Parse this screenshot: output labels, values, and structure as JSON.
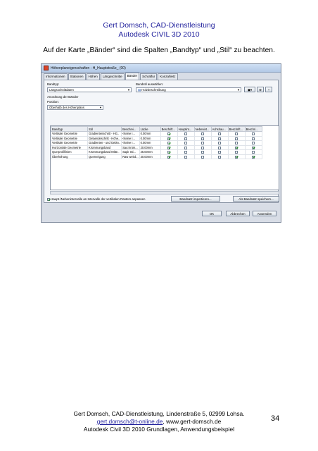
{
  "header": {
    "line1": "Gert Domsch, CAD-Dienstleistung",
    "line2": "Autodesk CIVIL 3D 2010"
  },
  "intro": "Auf der Karte „Bänder“ sind die Spalten „Bandtyp“ und „Stil“ zu beachten.",
  "dialog": {
    "title": "Höhenplaneigenschaften - H_Hauptstraße_ (00)",
    "tabs": [
      "Informationen",
      "Stationen",
      "Höhen",
      "Längsschnitte",
      "Bänder",
      "Schraffur",
      "Konzahletz"
    ],
    "active_tab": "Bänder",
    "bandtyp_label": "Bandtyp:",
    "bandtyp_value": "Längsschnittdaten",
    "bandstil_label": "Bandstil auswählen:",
    "bandstil_value": "Holzbeschreibung",
    "anordnung_label": "Anordnung der Bänder",
    "position_label": "Position:",
    "position_value": "Oberhalb des Höhenplans",
    "columns": [
      "Bandtyp",
      "Stil",
      "Beschrei...",
      "Lücke",
      "Beschrift...",
      "Hauptint...",
      "Nebenint...",
      "Achshau...",
      "Beschrift...",
      "Beschri..."
    ],
    "rows": [
      {
        "bandtyp": "Vertikale Geometrie",
        "stil": "Gradientenschritt - HG..",
        "beschr": "<keine I...",
        "luecke": "0.00mm",
        "c1": true,
        "c2": false,
        "c3": false,
        "c4": false,
        "c5": false,
        "c6": false
      },
      {
        "bandtyp": "Vertikale Geometrie",
        "stil": "Gelaendeschritt - Höhe..",
        "beschr": "<keine I...",
        "luecke": "0.00mm",
        "c1": true,
        "c2": false,
        "c3": false,
        "c4": false,
        "c5": false,
        "c6": false
      },
      {
        "bandtyp": "Vertikale Geometrie",
        "stil": "Gradienten - und Gelän..",
        "beschr": "<keine I...",
        "luecke": "0.00mm",
        "c1": true,
        "c2": false,
        "c3": false,
        "c4": false,
        "c5": false,
        "c6": false
      },
      {
        "bandtyp": "Horizontale Geometrie",
        "stil": "Krümmungsband",
        "beschr": "Sau:Krüm...",
        "luecke": "20.00mm",
        "c1": true,
        "c2": false,
        "c3": false,
        "c4": false,
        "c5": true,
        "c6": true
      },
      {
        "bandtyp": "Querprofillinien",
        "stil": "Krümmungsband Mitte..",
        "beschr": "Sapir Sti...",
        "luecke": "25.00mm",
        "c1": true,
        "c2": false,
        "c3": false,
        "c4": false,
        "c5": false,
        "c6": false
      },
      {
        "bandtyp": "Überhöhung",
        "stil": "Querneigung",
        "beschr": "Raw weird...",
        "luecke": "30.00mm",
        "c1": true,
        "c2": false,
        "c3": false,
        "c4": false,
        "c5": true,
        "c6": true
      }
    ],
    "sync_label": "Haupt-/Nebenintervalle an Intervalle der vertikalen Rasters anpassen",
    "btn_import": "Bandsatz importieren...",
    "btn_save": "Als Bandsatz speichern...",
    "btn_ok": "OK",
    "btn_cancel": "Abbrechen",
    "btn_apply": "Anwenden"
  },
  "footer": {
    "line1": "Gert Domsch, CAD-Dienstleistung, Lindenstraße 5, 02999 Lohsa.",
    "email": "gert.domsch@t-online.de",
    "web": ", www.gert-domsch.de",
    "line3": "Autodesk Civil 3D 2010 Grundlagen, Anwendungsbeispiel",
    "page": "34"
  }
}
